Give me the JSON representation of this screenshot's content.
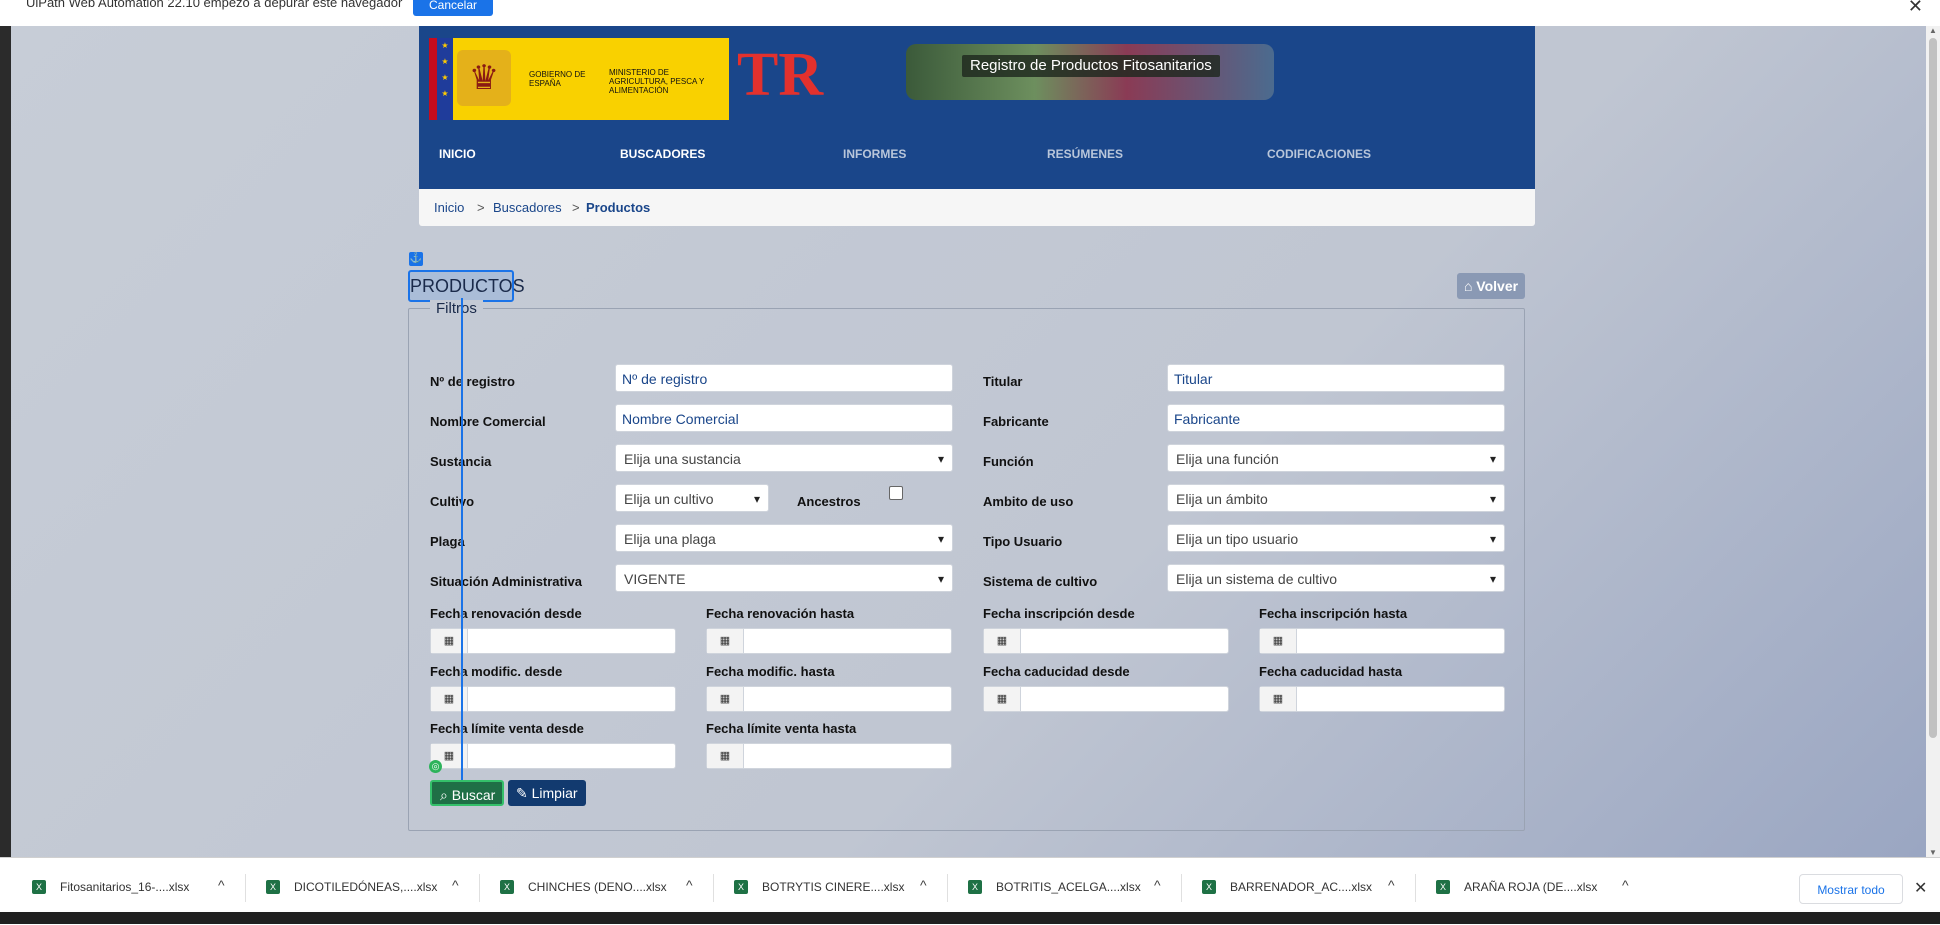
{
  "automation_bar": {
    "message": "UiPath Web Automation 22.10 empezó a depurar este navegador",
    "cancel_label": "Cancelar",
    "close_glyph": "✕"
  },
  "header": {
    "gov_text": "GOBIERNO DE ESPAÑA",
    "ministry_text": "MINISTERIO DE AGRICULTURA, PESCA Y ALIMENTACIÓN",
    "tr_logo_text": "TR",
    "banner_title": "Registro de Productos Fitosanitarios",
    "nav": [
      "INICIO",
      "BUSCADORES",
      "INFORMES",
      "RESÚMENES",
      "CODIFICACIONES"
    ]
  },
  "breadcrumb": {
    "home": "Inicio",
    "sep": ">",
    "section": "Buscadores",
    "current": "Productos"
  },
  "page": {
    "title": "PRODUCTOS",
    "back_label": "Volver",
    "legend": "Filtros"
  },
  "filters": {
    "registro": {
      "label": "Nº de registro",
      "placeholder": "Nº de registro"
    },
    "titular": {
      "label": "Titular",
      "placeholder": "Titular"
    },
    "nombre": {
      "label": "Nombre Comercial",
      "placeholder": "Nombre Comercial"
    },
    "fabricante": {
      "label": "Fabricante",
      "placeholder": "Fabricante"
    },
    "sustancia": {
      "label": "Sustancia",
      "value": "Elija una sustancia"
    },
    "funcion": {
      "label": "Función",
      "value": "Elija una función"
    },
    "cultivo": {
      "label": "Cultivo",
      "value": "Elija un cultivo"
    },
    "ancestros": {
      "label": "Ancestros",
      "checked": false
    },
    "ambito": {
      "label": "Ambito de uso",
      "value": "Elija un ámbito"
    },
    "plaga": {
      "label": "Plaga",
      "value": "Elija una plaga"
    },
    "tipo_usuario": {
      "label": "Tipo Usuario",
      "value": "Elija un tipo usuario"
    },
    "situacion": {
      "label": "Situación Administrativa",
      "value": "VIGENTE"
    },
    "sistema": {
      "label": "Sistema de cultivo",
      "value": "Elija un sistema de cultivo"
    },
    "dates": [
      "Fecha renovación desde",
      "Fecha renovación hasta",
      "Fecha inscripción desde",
      "Fecha inscripción hasta",
      "Fecha modific. desde",
      "Fecha modific. hasta",
      "Fecha caducidad desde",
      "Fecha caducidad hasta",
      "Fecha límite venta desde",
      "Fecha límite venta hasta"
    ]
  },
  "actions": {
    "search_label": "Buscar",
    "clear_label": "Limpiar"
  },
  "downloads": {
    "items": [
      "Fitosanitarios_16-....xlsx",
      "DICOTILEDÓNEAS,....xlsx",
      "CHINCHES (DENO....xlsx",
      "BOTRYTIS CINERE....xlsx",
      "BOTRITIS_ACELGA....xlsx",
      "BARRENADOR_AC....xlsx",
      "ARAÑA ROJA (DE....xlsx"
    ],
    "show_all": "Mostrar todo",
    "close_glyph": "✕"
  },
  "colors": {
    "header_blue": "#1a468a",
    "accent": "#1a73e8",
    "search_green": "#1f6f46",
    "clear_navy": "#123a6f"
  },
  "icons": {
    "dropdown": "▾",
    "calendar": "▦",
    "caret_up": "^"
  }
}
